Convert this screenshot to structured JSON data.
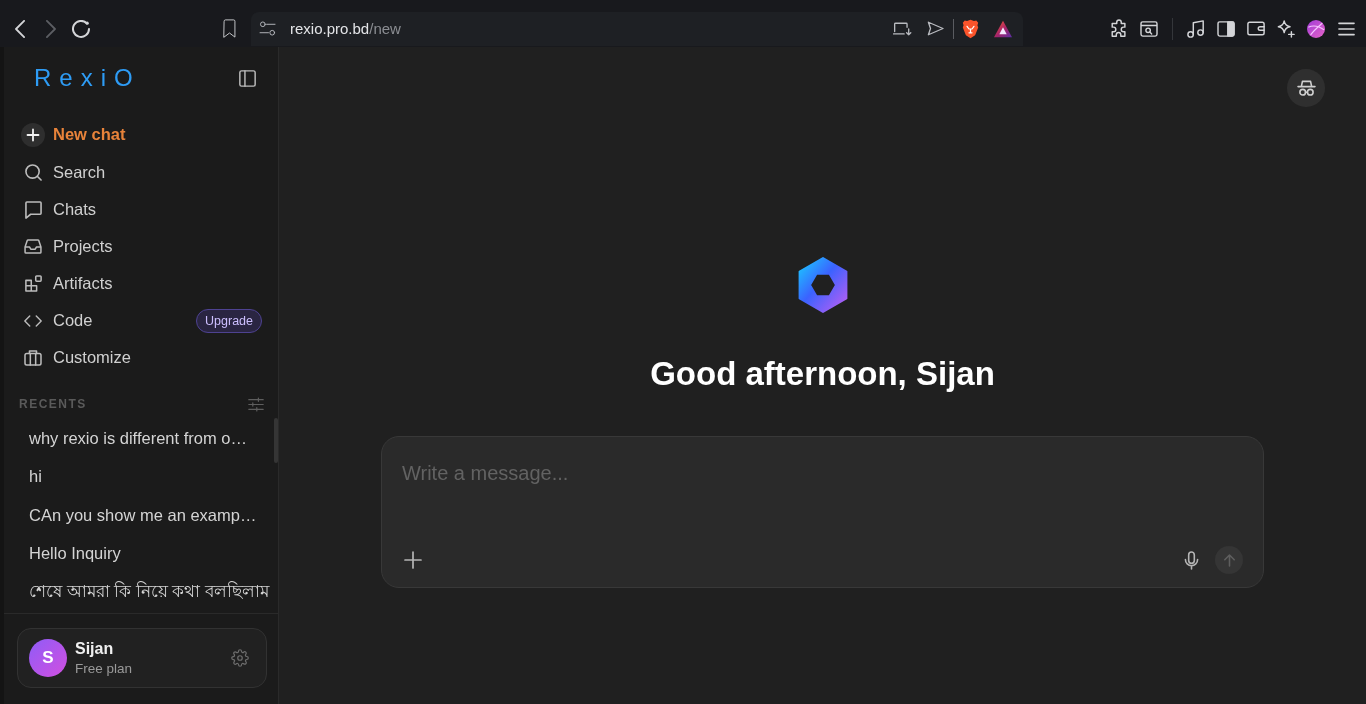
{
  "browser": {
    "nav": {
      "back_disabled": false,
      "forward_disabled": true
    },
    "url": {
      "host": "rexio.pro.bd",
      "path": "/new"
    }
  },
  "sidebar": {
    "logo": "RexiO",
    "new_chat": "New chat",
    "items": [
      {
        "kind": "search",
        "label": "Search"
      },
      {
        "kind": "chats",
        "label": "Chats"
      },
      {
        "kind": "projects",
        "label": "Projects"
      },
      {
        "kind": "artifacts",
        "label": "Artifacts"
      },
      {
        "kind": "code",
        "label": "Code",
        "badge": "Upgrade"
      },
      {
        "kind": "customize",
        "label": "Customize"
      }
    ],
    "recents": {
      "title": "RECENTS",
      "items": [
        "why rexio is different from o…",
        "hi",
        "CAn you show me an examp…",
        "Hello Inquiry",
        "শেষে আমরা কি নিয়ে কথা বলছিলাম"
      ]
    },
    "user": {
      "initial": "S",
      "name": "Sijan",
      "plan": "Free plan"
    }
  },
  "main": {
    "greeting": "Good afternoon, Sijan",
    "composer": {
      "placeholder": "Write a message...",
      "send_disabled": true
    }
  }
}
